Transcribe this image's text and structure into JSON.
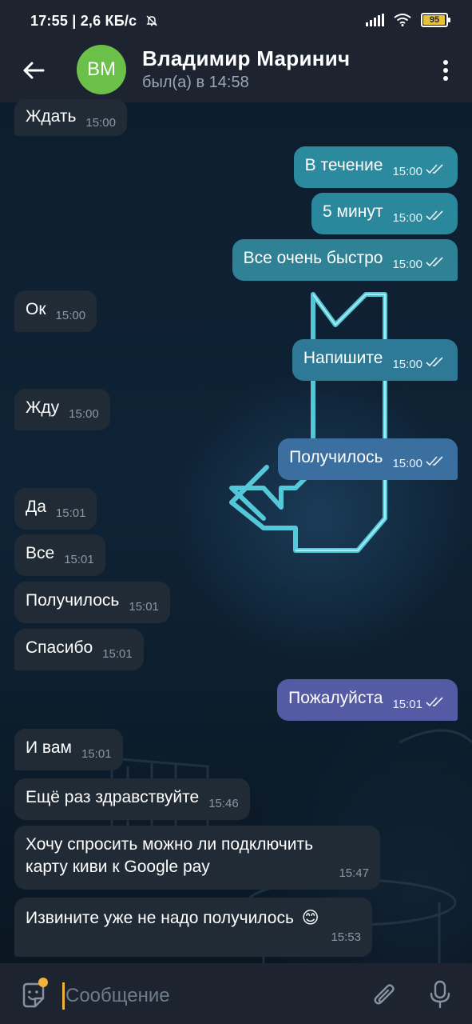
{
  "status_bar": {
    "time": "17:55",
    "net_speed": "2,6 КБ/с",
    "mute_icon": "bell-off-icon",
    "battery_level": "95"
  },
  "header": {
    "back_icon": "arrow-left-icon",
    "avatar_initials": "ВМ",
    "avatar_color": "#6bc04a",
    "contact_name": "Владимир Маринич",
    "last_seen": "был(а) в 14:58",
    "menu_icon": "more-vertical-icon"
  },
  "messages": [
    {
      "dir": "in",
      "text": "Ждать",
      "time": "15:00"
    },
    {
      "dir": "out",
      "text": "В течение",
      "time": "15:00"
    },
    {
      "dir": "out",
      "text": "5 минут",
      "time": "15:00"
    },
    {
      "dir": "out",
      "text": "Все очень быстро",
      "time": "15:00"
    },
    {
      "dir": "in",
      "text": "Ок",
      "time": "15:00"
    },
    {
      "dir": "out",
      "text": "Напишите",
      "time": "15:00"
    },
    {
      "dir": "in",
      "text": "Жду",
      "time": "15:00"
    },
    {
      "dir": "out",
      "text": "Получилось",
      "time": "15:00"
    },
    {
      "dir": "in",
      "text": "Да",
      "time": "15:01"
    },
    {
      "dir": "in",
      "text": "Все",
      "time": "15:01"
    },
    {
      "dir": "in",
      "text": "Получилось",
      "time": "15:01"
    },
    {
      "dir": "in",
      "text": "Спасибо",
      "time": "15:01"
    },
    {
      "dir": "out",
      "text": "Пожалуйста",
      "time": "15:01"
    },
    {
      "dir": "in",
      "text": "И вам",
      "time": "15:01"
    },
    {
      "dir": "in",
      "text": "Ещё раз здравствуйте",
      "time": "15:46"
    },
    {
      "dir": "in",
      "text_line1": "Хочу спросить можно ли подключить",
      "text_line2": "карту киви к Google pay",
      "time": "15:47"
    },
    {
      "dir": "in",
      "text": "Извините уже не надо получилось",
      "emoji": "😊",
      "time": "15:53"
    }
  ],
  "colors": {
    "incoming_bubble": "#212b36",
    "outgoing_bubbles": [
      "#2b8a9e",
      "#2a879c",
      "#2f8296",
      "#2d7996",
      "#3a6fa0",
      "#545aa3"
    ],
    "read_ticks": "#e7f2f6",
    "bar_background": "#1d2430",
    "accent": "#f2b33d"
  },
  "composer": {
    "emoji_icon": "sticker-smile-icon",
    "placeholder": "Сообщение",
    "attach_icon": "paperclip-icon",
    "mic_icon": "microphone-icon"
  }
}
